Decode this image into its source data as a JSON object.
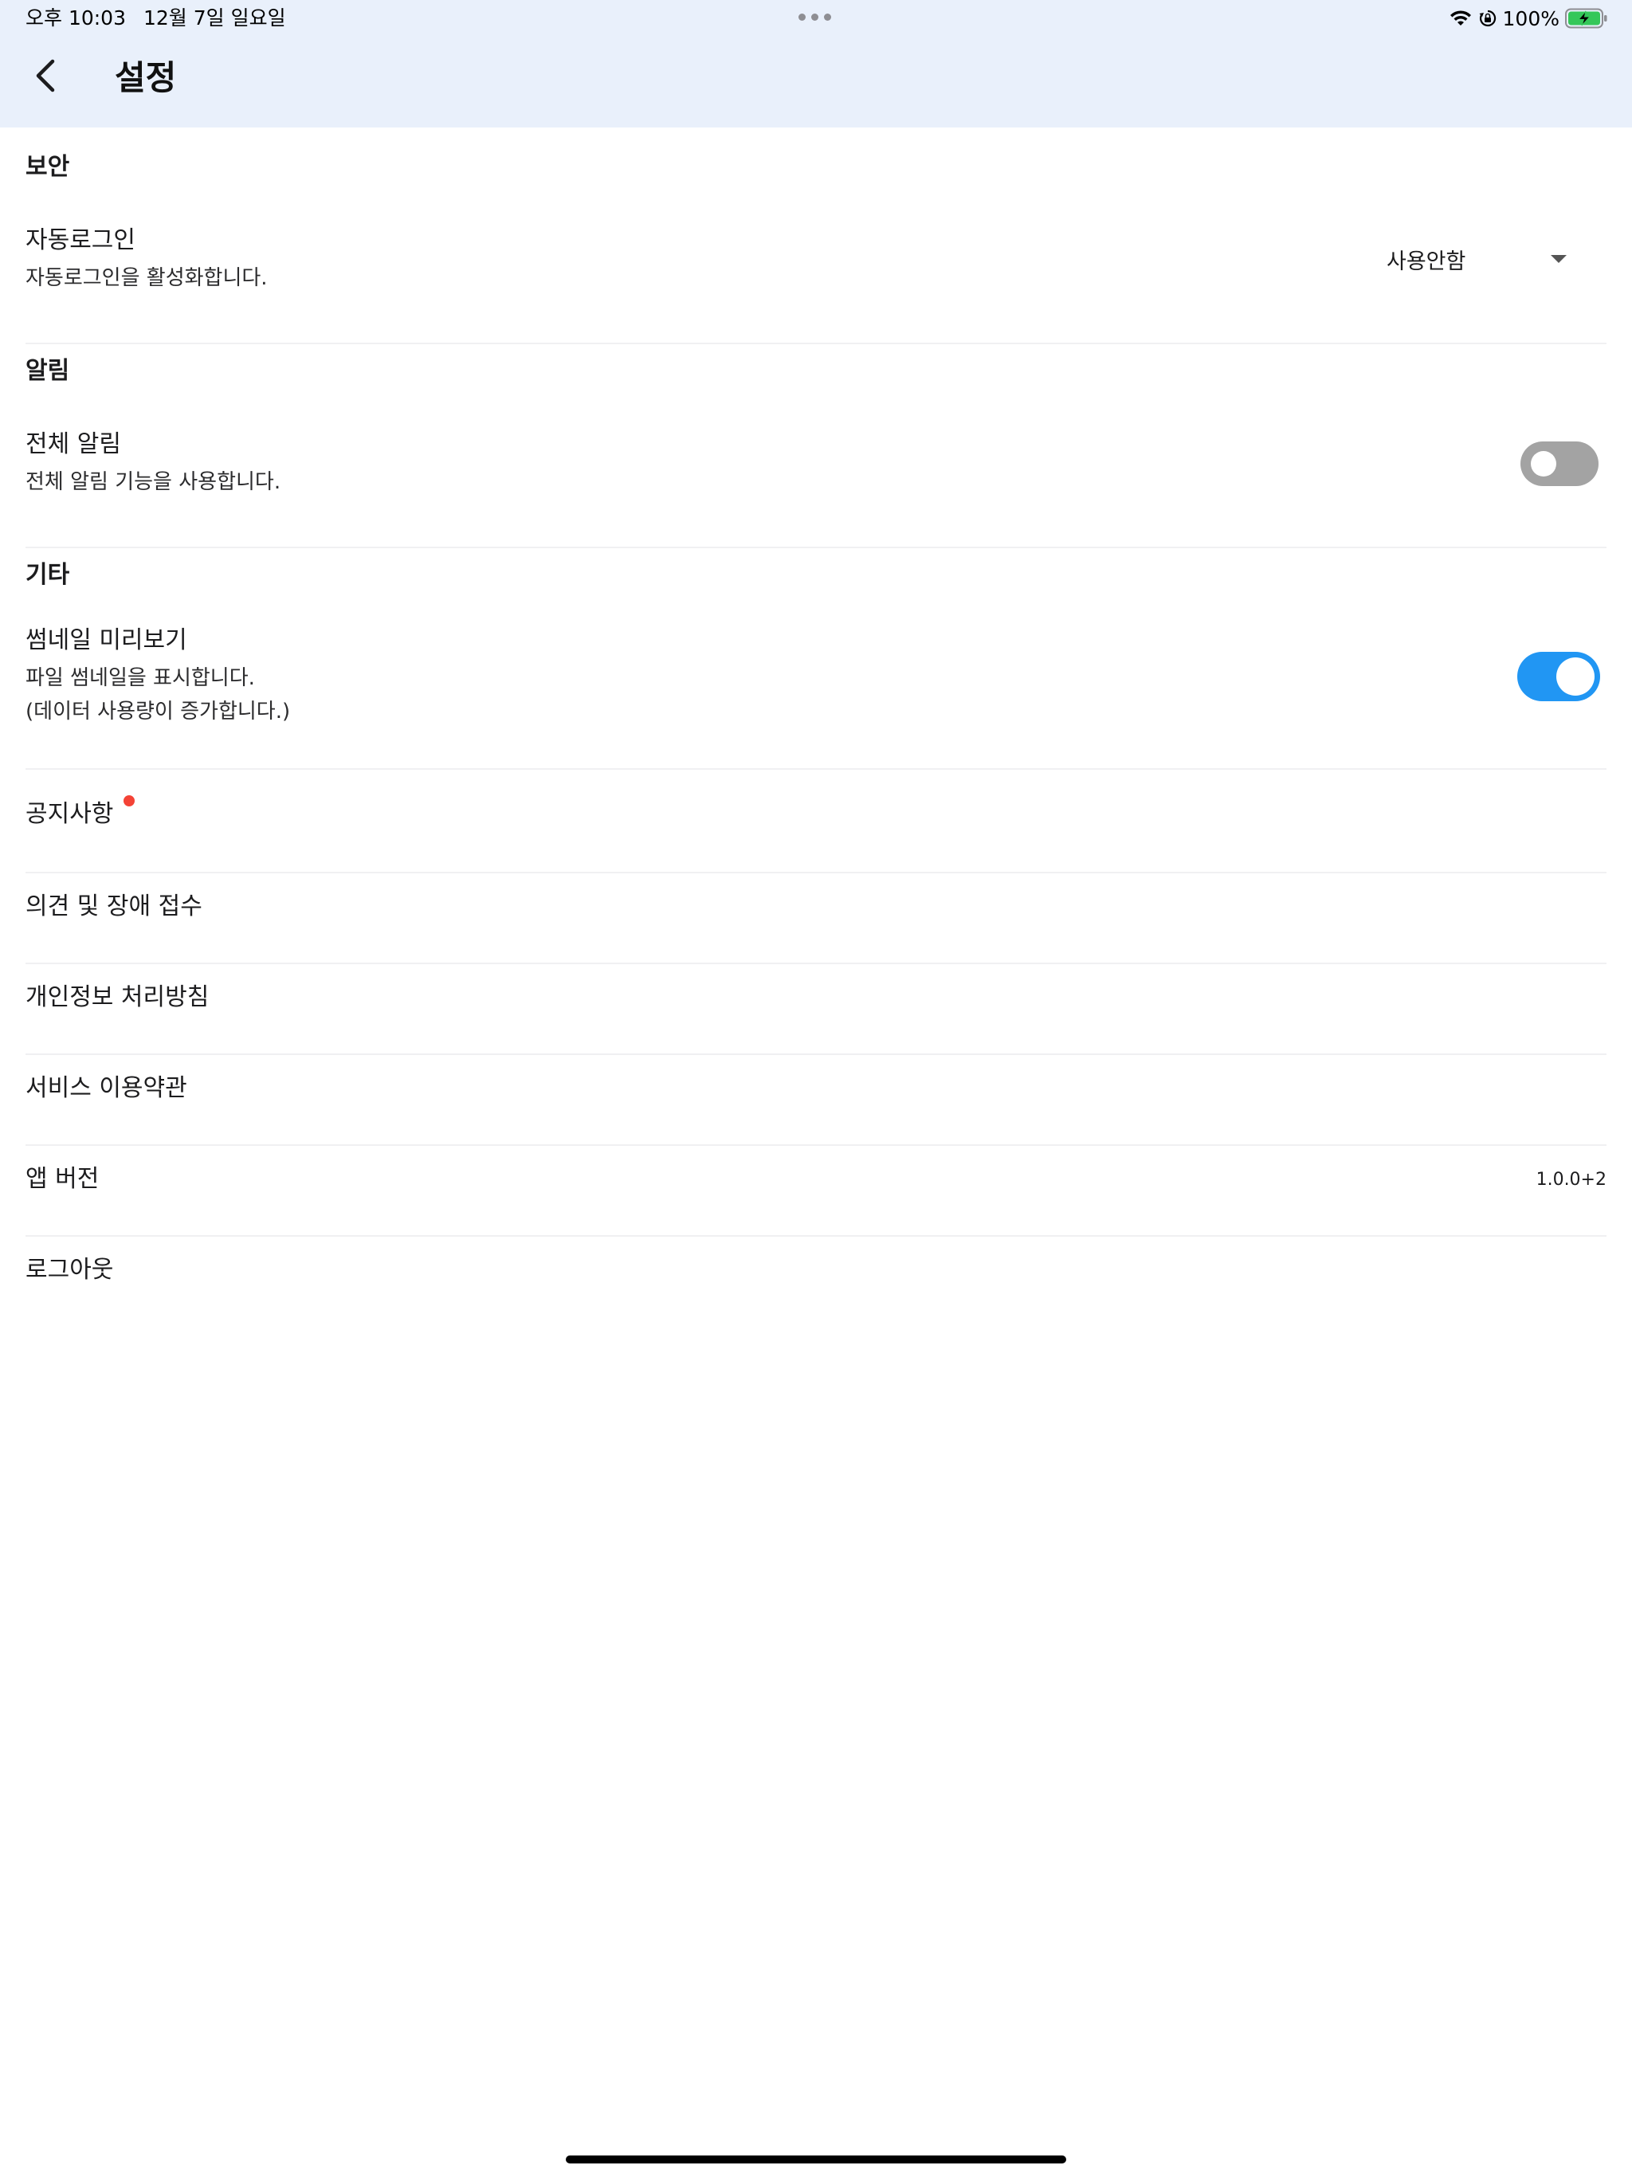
{
  "status_bar": {
    "time": "오후 10:03",
    "date": "12월 7일 일요일",
    "battery_percent": "100%",
    "icons": [
      "wifi-icon",
      "lock-rotation-icon",
      "battery-charging-icon"
    ]
  },
  "header": {
    "title": "설정",
    "back_icon": "back-arrow-icon"
  },
  "sections": {
    "security": {
      "header": "보안",
      "auto_login": {
        "title": "자동로그인",
        "description": "자동로그인을 활성화합니다.",
        "selected": "사용안함"
      }
    },
    "notifications": {
      "header": "알림",
      "all_notifications": {
        "title": "전체 알림",
        "description": "전체 알림 기능을 사용합니다.",
        "enabled": false
      }
    },
    "etc": {
      "header": "기타",
      "thumbnail_preview": {
        "title": "썸네일 미리보기",
        "description_line1": "파일 썸네일을 표시합니다.",
        "description_line2": "(데이터 사용량이 증가합니다.)",
        "enabled": true
      }
    }
  },
  "menu": {
    "notice": "공지사항",
    "feedback": "의견 및 장애 접수",
    "privacy_policy": "개인정보 처리방침",
    "terms": "서비스 이용약관",
    "app_version_label": "앱 버전",
    "app_version_value": "1.0.0+2",
    "logout": "로그아웃"
  },
  "colors": {
    "header_bg": "#e9f0fb",
    "toggle_on": "#2196f3",
    "toggle_off": "#a3a3a3",
    "badge_dot": "#f44336"
  }
}
